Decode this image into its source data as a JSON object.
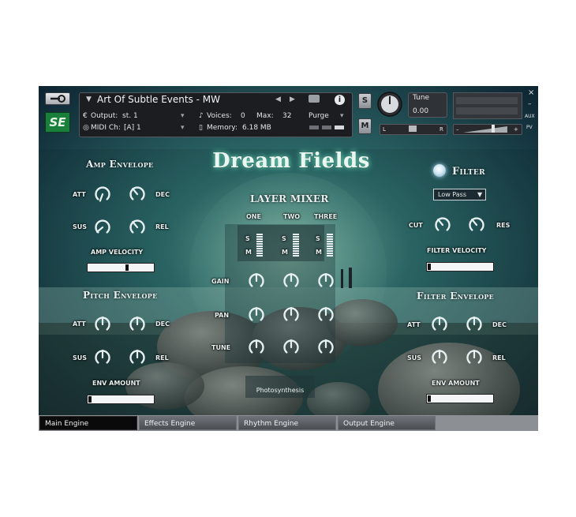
{
  "header": {
    "instrument_title": "Art Of Subtle Events - MW",
    "output_label": "Output:",
    "output_value": "st. 1",
    "voices_label": "Voices:",
    "voices_value": "0",
    "max_label": "Max:",
    "max_value": "32",
    "purge_label": "Purge",
    "midi_label": "MIDI Ch:",
    "midi_value": "[A]  1",
    "memory_label": "Memory:",
    "memory_value": "6.18 MB",
    "solo_label": "S",
    "mute_label": "M",
    "tune_label": "Tune",
    "tune_value": "0.00",
    "pan_left": "L",
    "pan_right": "R",
    "vol_minus": "–",
    "vol_plus": "+",
    "aux_label": "AUX",
    "pv_label": "PV",
    "close_glyph": "×",
    "minimize_glyph": "–",
    "logo_text": "SE"
  },
  "main": {
    "title": "Dream Fields",
    "amp_envelope": {
      "title": "Amp Envelope",
      "att": "ATT",
      "dec": "DEC",
      "sus": "SUS",
      "rel": "REL"
    },
    "amp_velocity": {
      "label": "AMP VELOCITY",
      "value": 0.6
    },
    "pitch_envelope": {
      "title": "Pitch Envelope",
      "att": "ATT",
      "dec": "DEC",
      "sus": "SUS",
      "rel": "REL"
    },
    "pitch_env_amount": {
      "label": "ENV AMOUNT",
      "value": 0.0
    },
    "layer_mixer": {
      "title": "LAYER MIXER",
      "layers": [
        "ONE",
        "TWO",
        "THREE"
      ],
      "solo": "S",
      "mute": "M",
      "gain_label": "GAIN",
      "pan_label": "PAN",
      "tune_label": "TUNE",
      "preset_name": "Photosynthesis"
    },
    "filter": {
      "label": "Filter",
      "type": "Low Pass",
      "cut": "CUT",
      "res": "RES"
    },
    "filter_velocity": {
      "label": "FILTER VELOCITY",
      "value": 0.0
    },
    "filter_envelope": {
      "title": "Filter Envelope",
      "att": "ATT",
      "dec": "DEC",
      "sus": "SUS",
      "rel": "REL"
    },
    "filter_env_amount": {
      "label": "ENV AMOUNT",
      "value": 0.0
    }
  },
  "tabs": [
    "Main Engine",
    "Effects Engine",
    "Rhythm Engine",
    "Output Engine"
  ],
  "colors": {
    "accent_green": "#1a8a3a",
    "title_glow": "#7fe0c8"
  }
}
